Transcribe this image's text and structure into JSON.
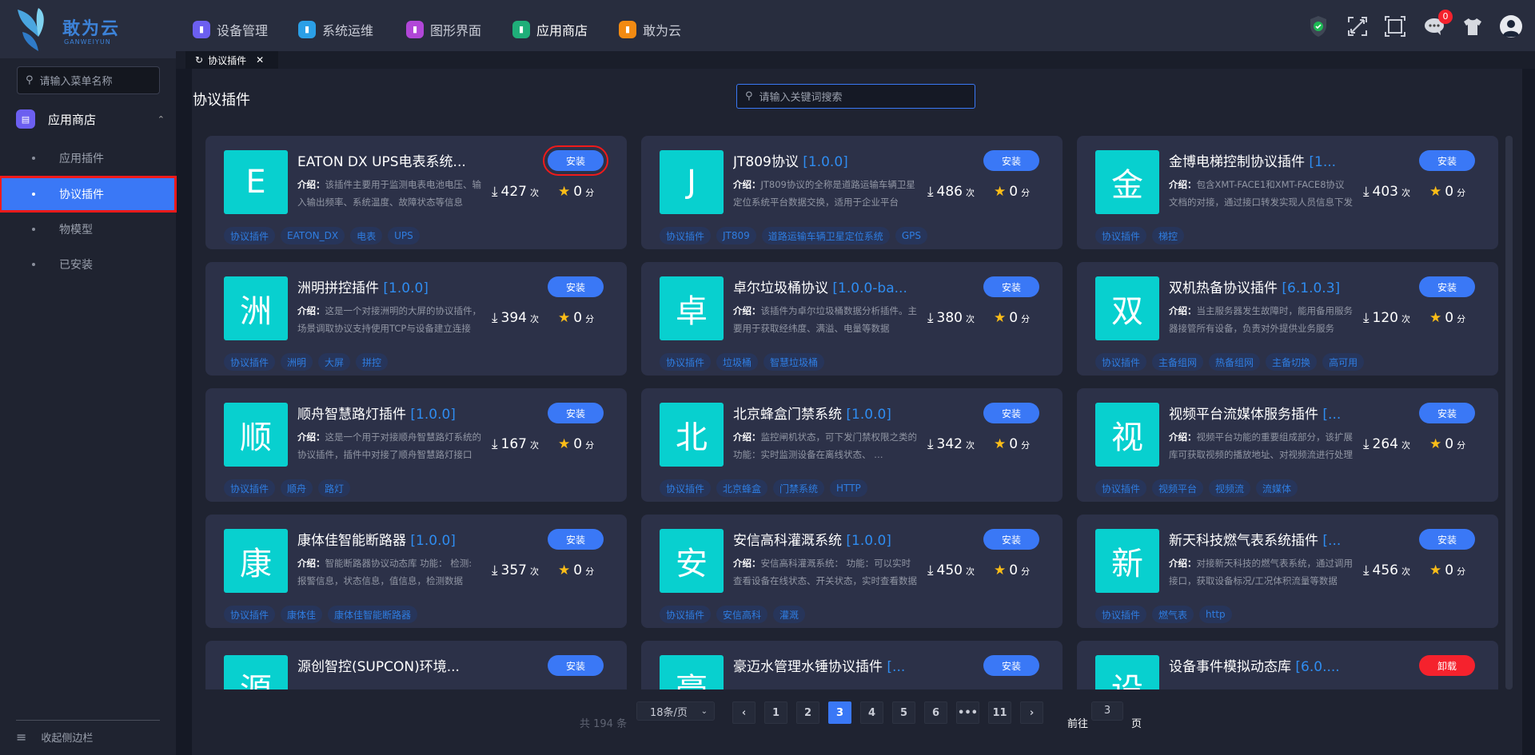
{
  "app": {
    "logo_text": "敢为云",
    "logo_sub": "GANWEIYUN"
  },
  "nav": [
    {
      "label": "设备管理",
      "color": "#6c5ff0",
      "icon": "device-icon"
    },
    {
      "label": "系统运维",
      "color": "#2b9fe6",
      "icon": "wrench-icon"
    },
    {
      "label": "图形界面",
      "color": "#b146d8",
      "icon": "screen-icon"
    },
    {
      "label": "应用商店",
      "color": "#1fae79",
      "icon": "store-icon",
      "active": true
    },
    {
      "label": "敢为云",
      "color": "#f28a12",
      "icon": "cloud-icon"
    }
  ],
  "header_icons": {
    "message_badge": "0"
  },
  "sidebar": {
    "search_placeholder": "请输入菜单名称",
    "group": "应用商店",
    "items": [
      "应用插件",
      "协议插件",
      "物模型",
      "已安装"
    ],
    "collapse": "收起侧边栏"
  },
  "tab": {
    "label": "协议插件"
  },
  "page": {
    "title": "协议插件",
    "search_placeholder": "请输入关键词搜索",
    "intro_label": "介绍：",
    "count_unit": "次",
    "score_unit": "分"
  },
  "cards": [
    {
      "icon": "E",
      "name": "EATON DX UPS电表系统...",
      "version": "",
      "desc": "该插件主要用于监测电表电池电压、输入输出频率、系统温度、故障状态等信息",
      "downloads": "427",
      "score": "0",
      "button": "安装",
      "tags": [
        "协议插件",
        "EATON_DX",
        "电表",
        "UPS"
      ]
    },
    {
      "icon": "J",
      "name": "JT809协议",
      "version": "[1.0.0]",
      "desc": "JT809协议的全称是道路运输车辆卫星定位系统平台数据交换，适用于企业平台",
      "downloads": "486",
      "score": "0",
      "button": "安装",
      "tags": [
        "协议插件",
        "JT809",
        "道路运输车辆卫星定位系统",
        "GPS"
      ]
    },
    {
      "icon": "金",
      "name": "金博电梯控制协议插件",
      "version": "[1...",
      "desc": "包含XMT-FACE1和XMT-FACE8协议文档的对接，通过接口转发实现人员信息下发",
      "downloads": "403",
      "score": "0",
      "button": "安装",
      "tags": [
        "协议插件",
        "梯控"
      ]
    },
    {
      "icon": "洲",
      "name": "洲明拼控插件",
      "version": "[1.0.0]",
      "desc": "这是一个对接洲明的大屏的协议插件，场景调取协议支持使用TCP与设备建立连接",
      "downloads": "394",
      "score": "0",
      "button": "安装",
      "tags": [
        "协议插件",
        "洲明",
        "大屏",
        "拼控"
      ]
    },
    {
      "icon": "卓",
      "name": "卓尔垃圾桶协议",
      "version": "[1.0.0-ba...",
      "desc": "该插件为卓尔垃圾桶数据分析插件。主要用于获取经纬度、满溢、电量等数据",
      "downloads": "380",
      "score": "0",
      "button": "安装",
      "tags": [
        "协议插件",
        "垃圾桶",
        "智慧垃圾桶"
      ]
    },
    {
      "icon": "双",
      "name": "双机热备协议插件",
      "version": "[6.1.0.3]",
      "desc": "当主服务器发生故障时，能用备用服务器接管所有设备，负责对外提供业务服务",
      "downloads": "120",
      "score": "0",
      "button": "安装",
      "tags": [
        "协议插件",
        "主备组网",
        "热备组网",
        "主备切换",
        "高可用"
      ]
    },
    {
      "icon": "顺",
      "name": "顺舟智慧路灯插件",
      "version": "[1.0.0]",
      "desc": "这是一个用于对接顺舟智慧路灯系统的协议插件，插件中对接了顺舟智慧路灯接口",
      "downloads": "167",
      "score": "0",
      "button": "安装",
      "tags": [
        "协议插件",
        "顺舟",
        "路灯"
      ]
    },
    {
      "icon": "北",
      "name": "北京蜂盒门禁系统",
      "version": "[1.0.0]",
      "desc": "监控闸机状态，可下发门禁权限之类的 功能：实时监测设备在离线状态、 …",
      "downloads": "342",
      "score": "0",
      "button": "安装",
      "tags": [
        "协议插件",
        "北京蜂盒",
        "门禁系统",
        "HTTP"
      ]
    },
    {
      "icon": "视",
      "name": "视频平台流媒体服务插件",
      "version": "[...",
      "desc": "视频平台功能的重要组成部分，该扩展库可获取视频的播放地址、对视频流进行处理",
      "downloads": "264",
      "score": "0",
      "button": "安装",
      "tags": [
        "协议插件",
        "视频平台",
        "视频流",
        "流媒体"
      ]
    },
    {
      "icon": "康",
      "name": "康体佳智能断路器",
      "version": "[1.0.0]",
      "desc": "智能断路器协议动态库 功能： 检测: 报警信息，状态信息，值信息，检测数据",
      "downloads": "357",
      "score": "0",
      "button": "安装",
      "tags": [
        "协议插件",
        "康体佳",
        "康体佳智能断路器"
      ]
    },
    {
      "icon": "安",
      "name": "安信高科灌溉系统",
      "version": "[1.0.0]",
      "desc": "安信高科灌溉系统： 功能：可以实时查看设备在线状态、开关状态，实时查看数据",
      "downloads": "450",
      "score": "0",
      "button": "安装",
      "tags": [
        "协议插件",
        "安信高科",
        "灌溉"
      ]
    },
    {
      "icon": "新",
      "name": "新天科技燃气表系统插件",
      "version": "[...",
      "desc": "对接新天科技的燃气表系统，通过调用接口，获取设备标况/工况体积流量等数据",
      "downloads": "456",
      "score": "0",
      "button": "安装",
      "tags": [
        "协议插件",
        "燃气表",
        "http"
      ]
    },
    {
      "icon": "源",
      "name": "源创智控(SUPCON)环境...",
      "version": "",
      "desc": "",
      "downloads": "",
      "score": "",
      "button": "安装",
      "tags": []
    },
    {
      "icon": "豪",
      "name": "豪迈水管理水锤协议插件",
      "version": "[...",
      "desc": "",
      "downloads": "",
      "score": "",
      "button": "安装",
      "tags": []
    },
    {
      "icon": "设",
      "name": "设备事件模拟动态库",
      "version": "[6.0....",
      "desc": "",
      "downloads": "",
      "score": "",
      "button": "卸载",
      "danger": true,
      "tags": []
    }
  ],
  "pagination": {
    "total": "共 194 条",
    "page_size": "18条/页",
    "pages": [
      "1",
      "2",
      "3",
      "4",
      "5",
      "6",
      "•••",
      "11"
    ],
    "current": "3",
    "goto_label": "前往",
    "goto_value": "3",
    "goto_suffix": "页"
  }
}
